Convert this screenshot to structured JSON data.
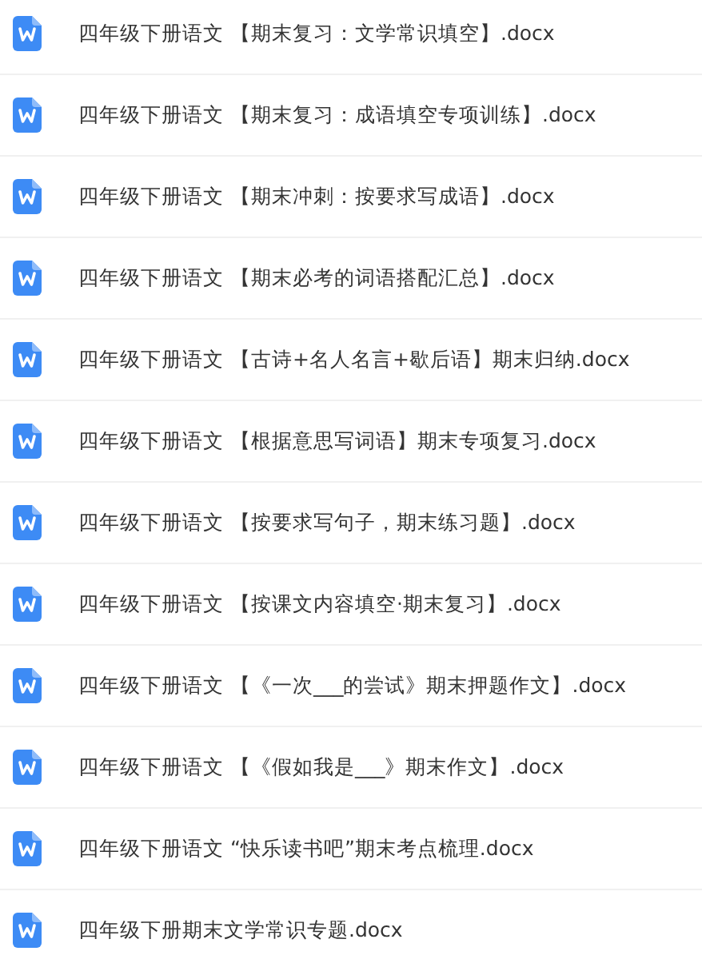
{
  "files": [
    {
      "name": "四年级下册语文 【期末复习：文学常识填空】.docx"
    },
    {
      "name": "四年级下册语文 【期末复习：成语填空专项训练】.docx"
    },
    {
      "name": "四年级下册语文 【期末冲刺：按要求写成语】.docx"
    },
    {
      "name": "四年级下册语文 【期末必考的词语搭配汇总】.docx"
    },
    {
      "name": "四年级下册语文 【古诗+名人名言+歇后语】期末归纳.docx"
    },
    {
      "name": "四年级下册语文 【根据意思写词语】期末专项复习.docx"
    },
    {
      "name": "四年级下册语文 【按要求写句子，期末练习题】.docx"
    },
    {
      "name": "四年级下册语文 【按课文内容填空·期末复习】.docx"
    },
    {
      "name": "四年级下册语文 【《一次___的尝试》期末押题作文】.docx"
    },
    {
      "name": "四年级下册语文 【《假如我是___》期末作文】.docx"
    },
    {
      "name": "四年级下册语文 “快乐读书吧”期末考点梳理.docx"
    },
    {
      "name": "四年级下册期末文学常识专题.docx"
    }
  ]
}
